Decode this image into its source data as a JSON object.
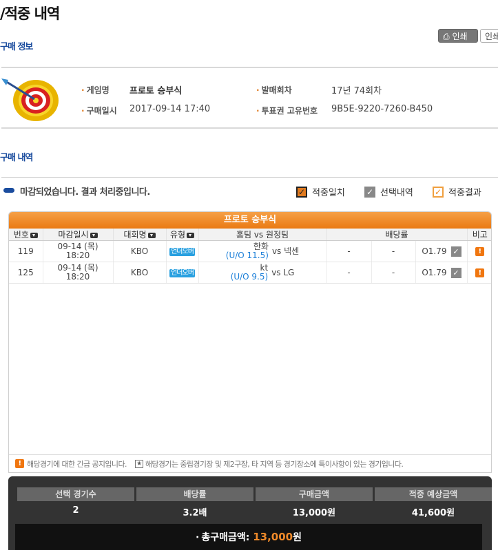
{
  "page": {
    "title": "/적중 내역",
    "print_label": "인쇄",
    "print_label_2": "인쇄"
  },
  "purchase_info": {
    "section_title": "구매 정보",
    "game_name_label": "게임명",
    "game_name": "프로토 승부식",
    "purchase_time_label": "구매일시",
    "purchase_time": "2017-09-14 17:40",
    "round_label": "발매회차",
    "round": "17년 74회차",
    "ticket_id_label": "투표권 고유번호",
    "ticket_id": "9B5E-9220-7260-B450"
  },
  "purchase_detail": {
    "section_title": "구매 내역",
    "status_text": "마감되었습니다. 결과 처리중입니다.",
    "legend": {
      "match": "적중일치",
      "selected": "선택내역",
      "result": "적중결과"
    }
  },
  "table": {
    "header_title": "프로토 승부식",
    "columns": {
      "no": "번호",
      "deadline": "마감일시",
      "league": "대회명",
      "type": "유형",
      "teams": "홈팀 vs 원정팀",
      "odds": "배당률",
      "note": "비고"
    },
    "rows": [
      {
        "no": "119",
        "date": "09-14 (목)",
        "time": "18:20",
        "league": "KBO",
        "type": "언더오버",
        "home": "한화",
        "line": "(U/O 11.5)",
        "vs": "vs",
        "away": "넥센",
        "odds_1": "-",
        "odds_2": "-",
        "odds_3": "O1.79"
      },
      {
        "no": "125",
        "date": "09-14 (목)",
        "time": "18:20",
        "league": "KBO",
        "type": "언더오버",
        "home": "kt",
        "line": "(U/O 9.5)",
        "vs": "vs",
        "away": "LG",
        "odds_1": "-",
        "odds_2": "-",
        "odds_3": "O1.79"
      }
    ],
    "note_alert": "해당경기에 대한 긴급 공지입니다.",
    "note_star": "해당경기는 중립경기장 및 제2구장, 타 지역 등 경기장소에 특이사항이 있는 경기입니다."
  },
  "summary": {
    "selected_games_label": "선택 경기수",
    "selected_games": "2",
    "odds_label": "배당률",
    "odds": "3.2배",
    "purchase_amount_label": "구매금액",
    "purchase_amount": "13,000원",
    "expected_label": "적중 예상금액",
    "expected": "41,600원",
    "total_label": "총구매금액:",
    "total_amount": "13,000",
    "total_unit": "원"
  },
  "colors": {
    "accent_orange": "#ea7a12",
    "brand_blue": "#1a4c9e",
    "tag_blue": "#29a0e0"
  }
}
